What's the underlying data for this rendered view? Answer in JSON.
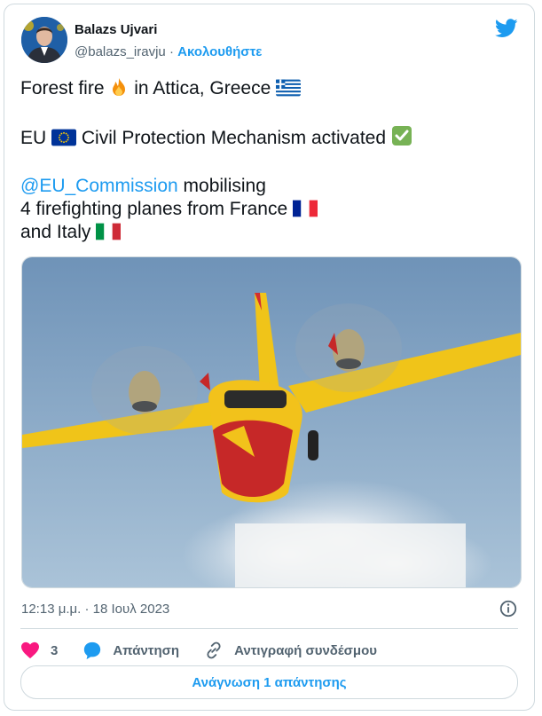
{
  "author": {
    "name": "Balazs Ujvari",
    "handle": "@balazs_iravju",
    "separator": "·",
    "follow_label": "Ακολουθήστε"
  },
  "tweet": {
    "line1_a": "Forest fire",
    "line1_b": "in Attica, Greece",
    "line2_a": "EU",
    "line2_b": "Civil Protection Mechanism activated",
    "line3_mention": "@EU_Commission",
    "line3_rest": " mobilising",
    "line4": "4 firefighting planes from France",
    "line5": "and Italy",
    "icons": [
      "fire-emoji",
      "greek-flag-emoji",
      "eu-flag-emoji",
      "check-mark-emoji",
      "french-flag-emoji",
      "italian-flag-emoji"
    ]
  },
  "timestamp": "12:13 μ.μ. · 18 Ιουλ 2023",
  "actions": {
    "likes": "3",
    "reply_label": "Απάντηση",
    "copy_link_label": "Αντιγραφή συνδέσμου"
  },
  "read_replies_label": "Ανάγνωση 1 απάντησης",
  "colors": {
    "accent": "#1d9bf0",
    "like": "#f91880",
    "muted": "#536471"
  }
}
